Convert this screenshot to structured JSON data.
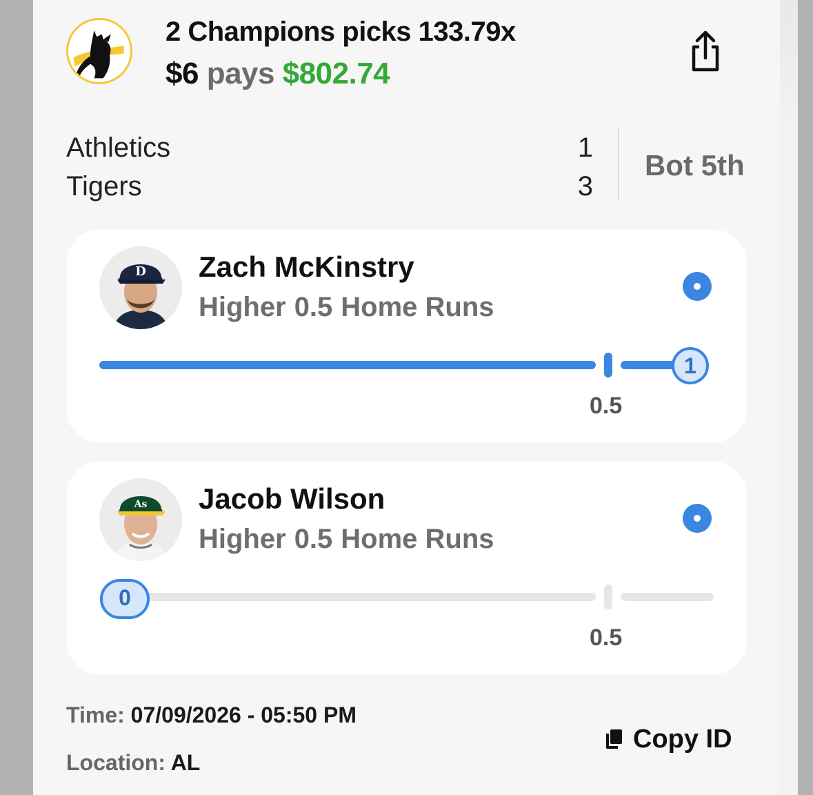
{
  "header": {
    "title": "2 Champions picks 133.79x",
    "stake": "$6",
    "pays_word": "pays",
    "payout": "$802.74",
    "share_icon": "share-icon",
    "logo_icon": "dog-logo-icon"
  },
  "game": {
    "teams": [
      {
        "name": "Athletics",
        "score": "1"
      },
      {
        "name": "Tigers",
        "score": "3"
      }
    ],
    "inning": "Bot 5th"
  },
  "picks": [
    {
      "player": "Zach McKinstry",
      "direction": "Higher",
      "line": "0.5",
      "stat": "Home Runs",
      "current_value": "1",
      "threshold_label": "0.5",
      "progress_fraction": 1.0,
      "status_icon": "live-indicator-icon"
    },
    {
      "player": "Jacob Wilson",
      "direction": "Higher",
      "line": "0.5",
      "stat": "Home Runs",
      "current_value": "0",
      "threshold_label": "0.5",
      "progress_fraction": 0.0,
      "status_icon": "live-indicator-icon"
    }
  ],
  "footer": {
    "time_label": "Time:",
    "time_value": "07/09/2026 - 05:50 PM",
    "location_label": "Location:",
    "location_value": "AL",
    "copy_label": "Copy ID",
    "copy_icon": "copy-icon"
  },
  "colors": {
    "accent_blue": "#3b86e0",
    "payout_green": "#35a836",
    "logo_yellow": "#f2c931"
  }
}
